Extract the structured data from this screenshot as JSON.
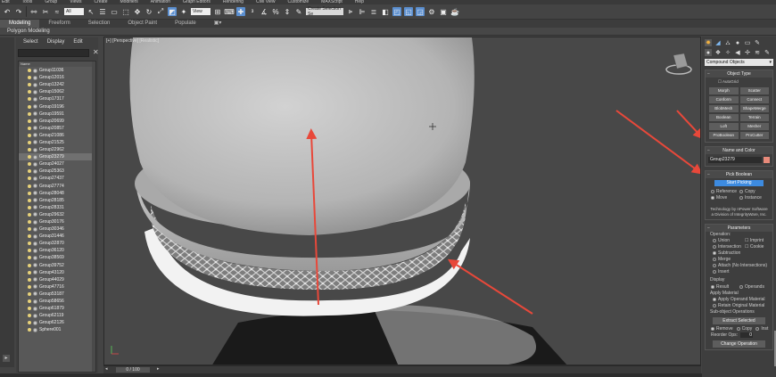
{
  "menubar": [
    "Edit",
    "Tools",
    "Group",
    "Views",
    "Create",
    "Modifiers",
    "Animation",
    "Graph Editors",
    "Rendering",
    "Civil View",
    "Customize",
    "MAXScript",
    "Help"
  ],
  "toolbar": {
    "filter_value": "All",
    "view_value": "View",
    "selection_set_value": "Create Selection Se"
  },
  "ribbon": {
    "tabs": [
      "Modeling",
      "Freeform",
      "Selection",
      "Object Paint",
      "Populate"
    ],
    "active_tab": "Modeling",
    "sub_label": "Polygon Modeling"
  },
  "explorer": {
    "menu": [
      "Select",
      "Display",
      "Edit"
    ],
    "column_header": "Name",
    "items": [
      "Group11036",
      "Group12016",
      "Group13242",
      "Group15062",
      "Group17317",
      "Group19196",
      "Group19591",
      "Group20699",
      "Group20857",
      "Group21086",
      "Group21525",
      "Group22962",
      "Group23279",
      "Group24027",
      "Group25363",
      "Group27437",
      "Group27774",
      "Group28048",
      "Group28185",
      "Group28331",
      "Group29632",
      "Group30176",
      "Group30346",
      "Group31446",
      "Group32870",
      "Group36120",
      "Group38569",
      "Group39752",
      "Group43120",
      "Group44029",
      "Group47716",
      "Group53187",
      "Group58656",
      "Group61879",
      "Group62119",
      "Group62126",
      "Sphere001"
    ],
    "selected": "Group23279"
  },
  "viewport": {
    "label": "[+] [Perspective] [Realistic]"
  },
  "timeslider": {
    "position": "0 / 100"
  },
  "command_panel": {
    "category": "Compound Objects",
    "object_type": {
      "title": "Object Type",
      "autogrid": "AutoGrid",
      "buttons": [
        "Morph",
        "Scatter",
        "Conform",
        "Connect",
        "BlobMesh",
        "ShapeMerge",
        "Boolean",
        "Terrain",
        "Loft",
        "Mesher",
        "ProBoolean",
        "ProCutter"
      ]
    },
    "name_color": {
      "title": "Name and Color",
      "name": "Group23279",
      "color": "#e88a7a"
    },
    "pick_boolean": {
      "title": "Pick Boolean",
      "button": "Start Picking",
      "options": [
        "Reference",
        "Copy",
        "Move",
        "Instance"
      ],
      "selected_option": "Move",
      "tech_text": "Technology by nPower Software a Division of IntegrityWare, Inc."
    },
    "parameters": {
      "title": "Parameters",
      "operation_label": "Operation:",
      "left_ops": [
        "Union",
        "Intersection",
        "Subtraction",
        "Merge",
        "Attach (No Intersections)",
        "Insert"
      ],
      "right_ops": [
        "Imprint",
        "Cookie"
      ],
      "selected_op": "Subtraction",
      "display_label": "Display",
      "display_options": [
        "Result",
        "Operands"
      ],
      "apply_material_label": "Apply Material",
      "apply_material_options": [
        "Apply Operand Material",
        "Retain Original Material"
      ],
      "sub_object_label": "Sub-object Operations",
      "extract_button": "Extract Selected",
      "remove_options": [
        "Remove",
        "Copy",
        "Inst"
      ],
      "reorder_label": "Reorder Ops:",
      "reorder_value": "0",
      "change_button": "Change Operation"
    }
  },
  "colors": {
    "accent_blue": "#3d8be0",
    "annotation_red": "#e8483a",
    "background": "#444444"
  }
}
